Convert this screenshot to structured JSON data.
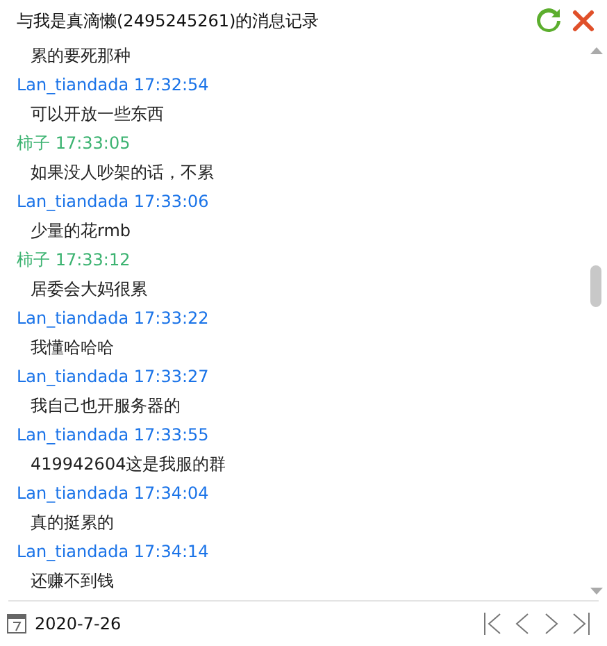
{
  "window": {
    "title": "与我是真滴懒(2495245261)的消息记录"
  },
  "entries": [
    {
      "kind": "message",
      "text": "累的要死那种"
    },
    {
      "kind": "header",
      "sender": "Lan_tiandada",
      "time": "17:32:54",
      "color": "#1a73e8"
    },
    {
      "kind": "message",
      "text": "可以开放一些东西"
    },
    {
      "kind": "header",
      "sender": "柿子",
      "time": "17:33:05",
      "color": "#3cb371"
    },
    {
      "kind": "message",
      "text": "如果没人吵架的话，不累"
    },
    {
      "kind": "header",
      "sender": "Lan_tiandada",
      "time": "17:33:06",
      "color": "#1a73e8"
    },
    {
      "kind": "message",
      "text": "少量的花rmb"
    },
    {
      "kind": "header",
      "sender": "柿子",
      "time": "17:33:12",
      "color": "#3cb371"
    },
    {
      "kind": "message",
      "text": "居委会大妈很累"
    },
    {
      "kind": "header",
      "sender": "Lan_tiandada",
      "time": "17:33:22",
      "color": "#1a73e8"
    },
    {
      "kind": "message",
      "text": "我懂哈哈哈"
    },
    {
      "kind": "header",
      "sender": "Lan_tiandada",
      "time": "17:33:27",
      "color": "#1a73e8"
    },
    {
      "kind": "message",
      "text": "我自己也开服务器的"
    },
    {
      "kind": "header",
      "sender": "Lan_tiandada",
      "time": "17:33:55",
      "color": "#1a73e8"
    },
    {
      "kind": "message",
      "text": "419942604这是我服的群"
    },
    {
      "kind": "header",
      "sender": "Lan_tiandada",
      "time": "17:34:04",
      "color": "#1a73e8"
    },
    {
      "kind": "message",
      "text": "真的挺累的"
    },
    {
      "kind": "header",
      "sender": "Lan_tiandada",
      "time": "17:34:14",
      "color": "#1a73e8"
    },
    {
      "kind": "message",
      "text": "还赚不到钱"
    }
  ],
  "footer": {
    "date": "2020-7-26"
  }
}
